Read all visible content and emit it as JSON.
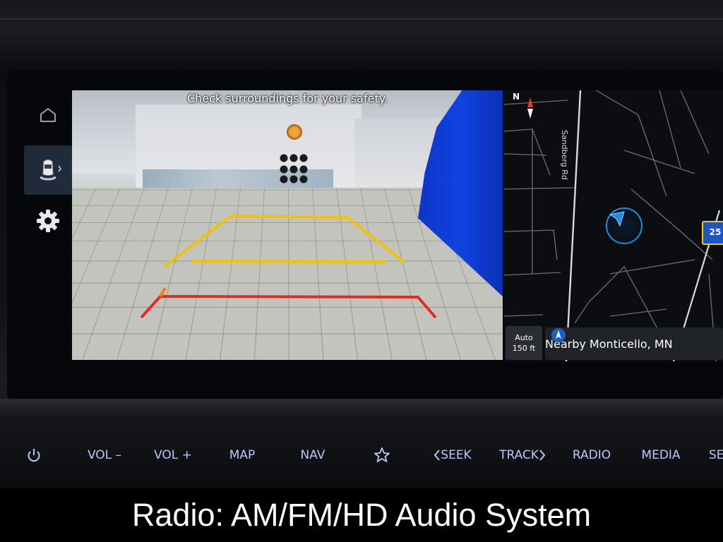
{
  "rail": {
    "items": [
      {
        "id": "home",
        "icon": "home-icon"
      },
      {
        "id": "parking",
        "icon": "car-sensor-icon",
        "active": true
      },
      {
        "id": "settings",
        "icon": "gear-icon"
      }
    ]
  },
  "camera": {
    "safety_message": "Check surroundings for your safety."
  },
  "map": {
    "north_label": "N",
    "road_label": "Sandberg Rd",
    "highway_shield": "25",
    "scale_mode": "Auto",
    "scale_value": "150 ft",
    "location_text": "Nearby Monticello, MN"
  },
  "buttons": {
    "vol_down": "VOL –",
    "vol_up": "VOL +",
    "map": "MAP",
    "nav": "NAV",
    "seek": "SEEK",
    "track": "TRACK",
    "radio": "RADIO",
    "media": "MEDIA",
    "setup": "SE"
  },
  "caption": "Radio: AM/FM/HD Audio System",
  "colors": {
    "accent": "#bcc7ff",
    "guide_yellow": "#f2c200",
    "guide_red": "#e52a1f",
    "nav_blue": "#1b8fe8"
  }
}
